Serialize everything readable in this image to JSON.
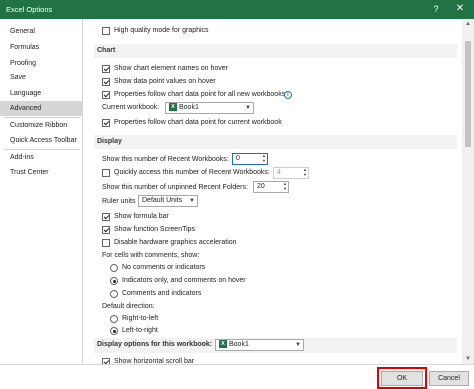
{
  "window": {
    "title": "Excel Options",
    "help_glyph": "?",
    "close_glyph": "✕"
  },
  "sidebar": {
    "items": [
      {
        "label": "General"
      },
      {
        "label": "Formulas"
      },
      {
        "label": "Proofing"
      },
      {
        "label": "Save"
      },
      {
        "label": "Language"
      },
      {
        "label": "Advanced"
      },
      {
        "label": "Customize Ribbon"
      },
      {
        "label": "Quick Access Toolbar"
      },
      {
        "label": "Add-ins"
      },
      {
        "label": "Trust Center"
      }
    ],
    "active": "Advanced"
  },
  "content": {
    "top_partial": {
      "label": "High quality mode for graphics",
      "checked": false
    },
    "chart": {
      "heading": "Chart",
      "show_element_names": {
        "label": "Show chart element names on hover",
        "checked": true
      },
      "show_data_values": {
        "label": "Show data point values on hover",
        "checked": true
      },
      "props_follow_all": {
        "label": "Properties follow chart data point for all new workbooks",
        "checked": true
      },
      "current_workbook_label": "Current workbook:",
      "current_workbook_value": "Book1",
      "props_follow_current": {
        "label": "Properties follow chart data point for current workbook",
        "checked": true
      }
    },
    "display": {
      "heading": "Display",
      "recent_workbooks_label": "Show this number of Recent Workbooks:",
      "recent_workbooks_value": "0",
      "quick_access_label": "Quickly access this number of Recent Workbooks:",
      "quick_access_value": "4",
      "unpinned_folders_label": "Show this number of unpinned Recent Folders:",
      "unpinned_folders_value": "20",
      "ruler_units_label": "Ruler units",
      "ruler_units_value": "Default Units",
      "show_formula_bar": {
        "label": "Show formula bar",
        "checked": true
      },
      "show_screentips": {
        "label": "Show function ScreenTips",
        "checked": true
      },
      "disable_hw_accel": {
        "label": "Disable hardware graphics acceleration",
        "checked": false
      },
      "comments_label": "For cells with comments, show:",
      "comments_options": [
        {
          "label": "No comments or indicators",
          "selected": false
        },
        {
          "label": "Indicators only, and comments on hover",
          "selected": true
        },
        {
          "label": "Comments and indicators",
          "selected": false
        }
      ],
      "direction_label": "Default direction:",
      "direction_options": [
        {
          "label": "Right-to-left",
          "selected": false
        },
        {
          "label": "Left-to-right",
          "selected": true
        }
      ]
    },
    "display_workbook": {
      "heading": "Display options for this workbook:",
      "workbook_value": "Book1",
      "show_h_scroll": {
        "label": "Show horizontal scroll bar",
        "checked": true
      }
    }
  },
  "footer": {
    "ok_label": "OK",
    "cancel_label": "Cancel"
  },
  "colors": {
    "title_bar": "#217346",
    "highlight_box": "#e00000"
  }
}
